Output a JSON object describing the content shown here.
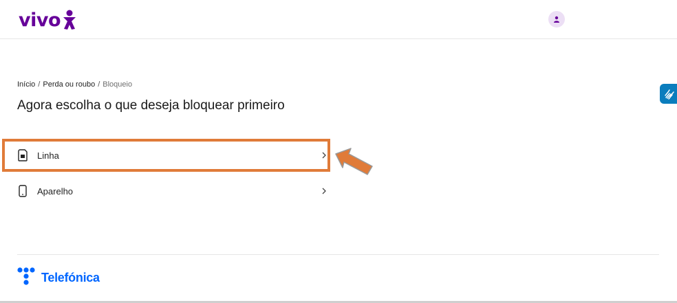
{
  "header": {
    "logo_text": "vivo",
    "avatar_icon": "user-icon"
  },
  "breadcrumb": {
    "items": [
      "Início",
      "Perda ou roubo",
      "Bloqueio"
    ],
    "separator": "/"
  },
  "main": {
    "title": "Agora escolha o que deseja bloquear primeiro",
    "options": [
      {
        "label": "Linha",
        "icon": "sim-card-icon"
      },
      {
        "label": "Aparelho",
        "icon": "smartphone-icon"
      }
    ]
  },
  "accessibility": {
    "icon": "sign-language-icon"
  },
  "footer": {
    "brand": "Telefónica"
  },
  "colors": {
    "brand_purple": "#660099",
    "highlight_orange": "#e07b39",
    "telefonica_blue": "#0066ff",
    "a11y_blue": "#0b7dbd"
  }
}
